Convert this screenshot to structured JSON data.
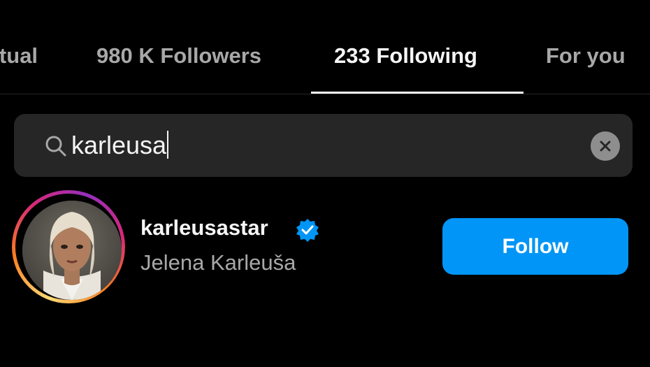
{
  "tabs": [
    {
      "label": "utual",
      "active": false
    },
    {
      "label": "980 K Followers",
      "active": false
    },
    {
      "label": "233 Following",
      "active": true
    },
    {
      "label": "For you",
      "active": false
    }
  ],
  "search": {
    "value": "karleusa",
    "icon": "search-icon",
    "clear_icon": "close-icon"
  },
  "results": [
    {
      "username": "karleusastar",
      "verified": true,
      "full_name": "Jelena Karleuša",
      "action_label": "Follow"
    }
  ],
  "colors": {
    "background": "#000000",
    "accent": "#0095f6",
    "search_bg": "#262626",
    "muted_text": "#a8a8a8",
    "verified": "#0095f6"
  }
}
